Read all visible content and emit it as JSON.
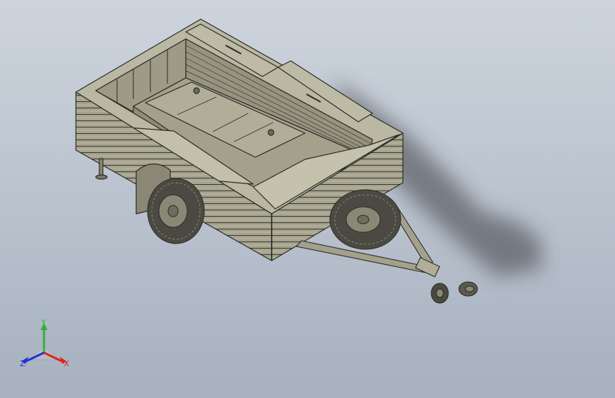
{
  "viewport": {
    "background_top": "#cdd4dd",
    "background_bottom": "#a7b1bf",
    "model_fill": "#a3a08c",
    "model_fill_light": "#bab7a3",
    "model_fill_dark": "#7a7868",
    "edge_color": "#2b2b26",
    "tire_color": "#4b4a42",
    "shadow_color": "#3d3f44"
  },
  "triad": {
    "x_label": "X",
    "y_label": "Y",
    "z_label": "Z",
    "x_color": "#e0231c",
    "y_color": "#2fb23a",
    "z_color": "#2230d8"
  }
}
